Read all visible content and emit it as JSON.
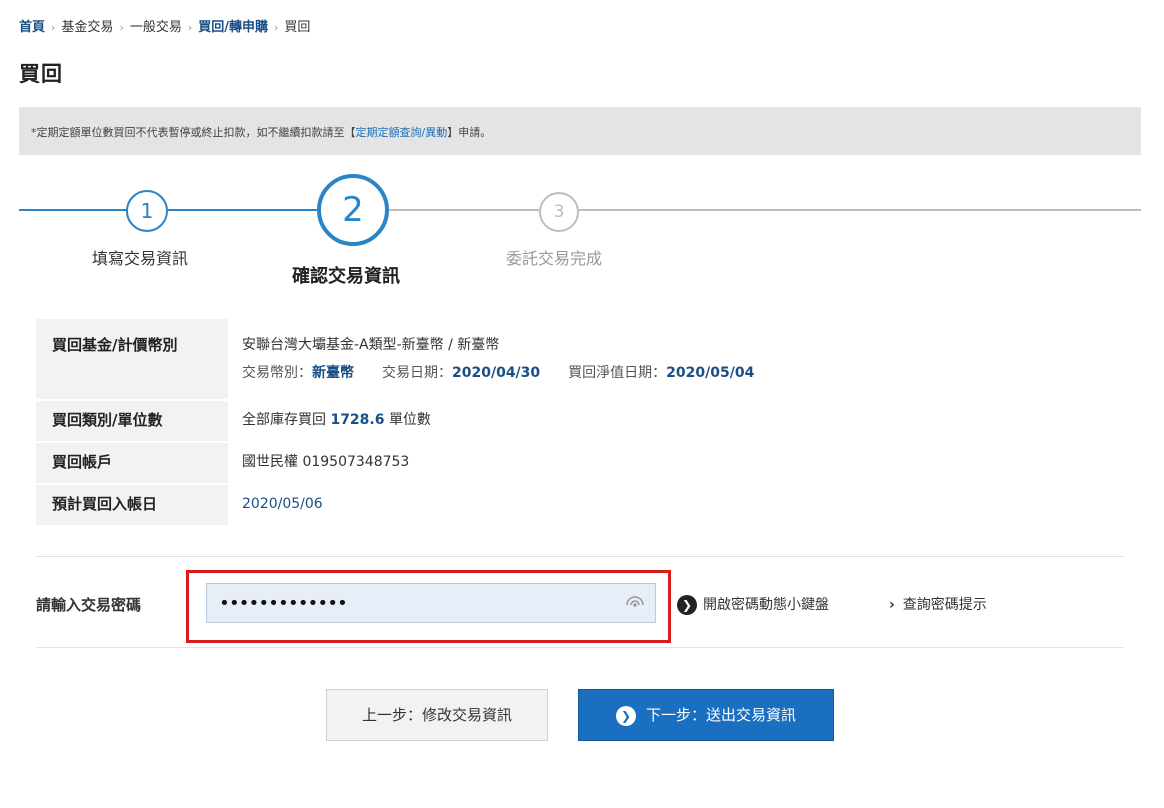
{
  "breadcrumb": [
    "首頁",
    "基金交易",
    "一般交易",
    "買回/轉申購",
    "買回"
  ],
  "page_title": "買回",
  "notice": {
    "prefix": "*定期定額單位數買回不代表暫停或終止扣款，如不繼續扣款請至【",
    "link": "定期定額查詢/異動",
    "suffix": "】申請。"
  },
  "steps": [
    {
      "num": "1",
      "label": "填寫交易資訊",
      "state": "done"
    },
    {
      "num": "2",
      "label": "確認交易資訊",
      "state": "current"
    },
    {
      "num": "3",
      "label": "委託交易完成",
      "state": "pending"
    }
  ],
  "info": {
    "fund_label": "買回基金/計價幣別",
    "fund_value": "安聯台灣大壩基金-A類型-新臺幣 / 新臺幣",
    "currency_label": "交易幣別：",
    "currency_value": "新臺幣",
    "trade_date_label": "交易日期：",
    "trade_date_value": "2020/04/30",
    "nav_date_label": "買回淨值日期：",
    "nav_date_value": "2020/05/04",
    "type_label": "買回類別/單位數",
    "type_prefix": "全部庫存買回",
    "units": "1728.6",
    "units_suffix": "單位數",
    "account_label": "買回帳戶",
    "account_value": "國世民權 019507348753",
    "settle_label": "預計買回入帳日",
    "settle_value": "2020/05/06"
  },
  "password": {
    "label": "請輸入交易密碼",
    "value": "•••••••••••••",
    "keyboard_link": "開啟密碼動態小鍵盤",
    "hint_link": "查詢密碼提示"
  },
  "buttons": {
    "prev": "上一步：修改交易資訊",
    "next": "下一步：送出交易資訊"
  },
  "colors": {
    "accent": "#2a85c8",
    "primary_button": "#1b6fc0",
    "highlight_box": "#d71a1a"
  }
}
